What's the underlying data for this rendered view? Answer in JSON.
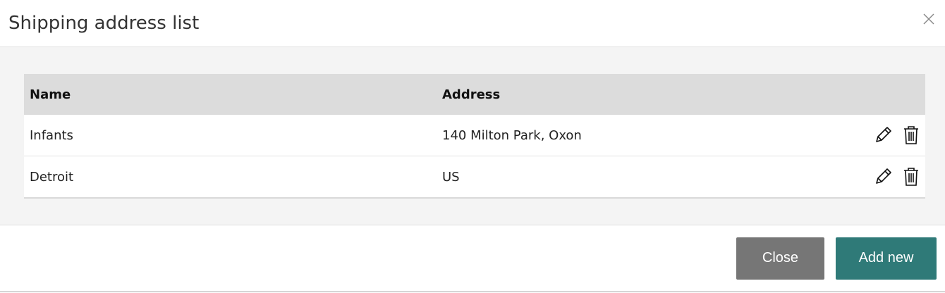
{
  "dialog": {
    "title": "Shipping address list",
    "close_icon": "close-x-icon"
  },
  "table": {
    "columns": [
      "Name",
      "Address"
    ],
    "rows": [
      {
        "name": "Infants",
        "address": "140 Milton Park, Oxon",
        "edit_icon": "pencil-icon",
        "delete_icon": "trash-icon"
      },
      {
        "name": "Detroit",
        "address": "US",
        "edit_icon": "pencil-icon",
        "delete_icon": "trash-icon"
      }
    ]
  },
  "footer": {
    "close_label": "Close",
    "add_label": "Add new"
  },
  "colors": {
    "header_bg": "#dcdcdc",
    "body_bg": "#f4f4f4",
    "close_button": "#767676",
    "add_button": "#2f7a78"
  }
}
